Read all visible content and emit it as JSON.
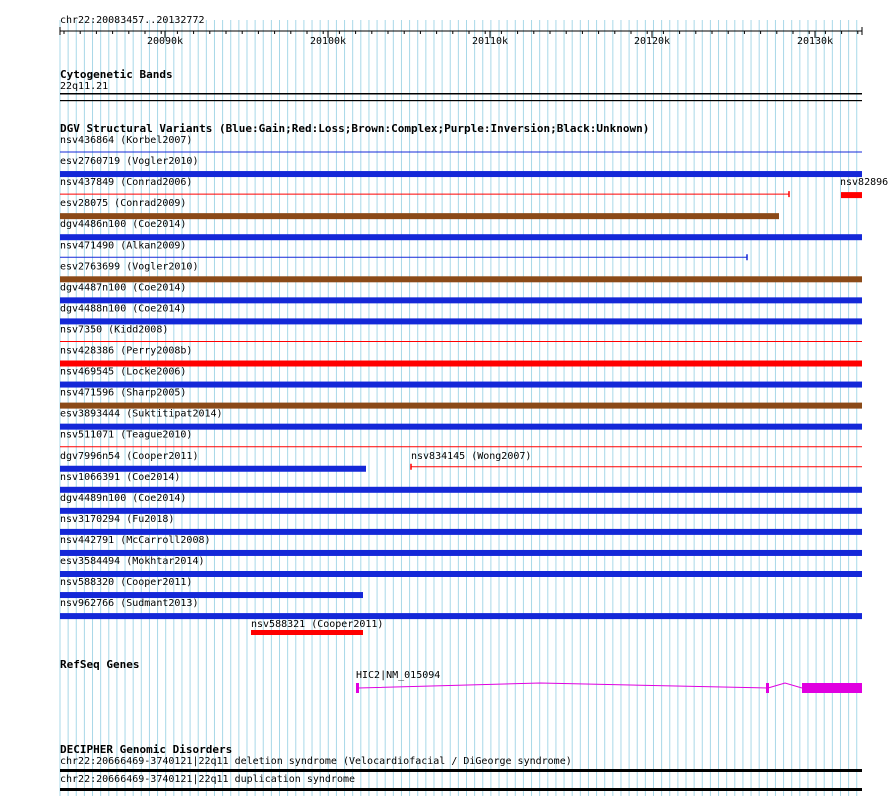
{
  "ruler": {
    "region": "chr22:20083457..20132772",
    "start": 20083457,
    "end": 20132772,
    "tick_labels": [
      "20090k",
      "20100k",
      "20110k",
      "20120k",
      "20130k"
    ]
  },
  "cytoband": {
    "title": "Cytogenetic Bands",
    "band": "22q11.21"
  },
  "dgv": {
    "title": "DGV Structural Variants (Blue:Gain;Red:Loss;Brown:Complex;Purple:Inversion;Black:Unknown)",
    "legend_colors": {
      "gain": "#1428d8",
      "loss": "#ff0000",
      "complex": "#8b4a18",
      "inversion": "#800080",
      "unknown": "#000000"
    },
    "features": [
      {
        "label": "nsv436864 (Korbel2007)",
        "type": "gain",
        "style": "line"
      },
      {
        "label": "esv2760719 (Vogler2010)",
        "type": "gain",
        "style": "bar"
      },
      {
        "label": "nsv437849 (Conrad2006)",
        "type": "loss",
        "style": "line-end",
        "extra_label": "nsv82896"
      },
      {
        "label": "esv28075 (Conrad2009)",
        "type": "complex",
        "style": "bar-partial"
      },
      {
        "label": "dgv4486n100 (Coe2014)",
        "type": "gain",
        "style": "bar"
      },
      {
        "label": "nsv471490 (Alkan2009)",
        "type": "gain",
        "style": "line-end"
      },
      {
        "label": "esv2763699 (Vogler2010)",
        "type": "complex",
        "style": "bar"
      },
      {
        "label": "dgv4487n100 (Coe2014)",
        "type": "gain",
        "style": "bar"
      },
      {
        "label": "dgv4488n100 (Coe2014)",
        "type": "gain",
        "style": "bar"
      },
      {
        "label": "nsv7350 (Kidd2008)",
        "type": "loss",
        "style": "line"
      },
      {
        "label": "nsv428386 (Perry2008b)",
        "type": "loss",
        "style": "bar"
      },
      {
        "label": "nsv469545 (Locke2006)",
        "type": "gain",
        "style": "bar"
      },
      {
        "label": "nsv471596 (Sharp2005)",
        "type": "complex",
        "style": "bar"
      },
      {
        "label": "esv3893444 (Suktitipat2014)",
        "type": "gain",
        "style": "bar"
      },
      {
        "label": "nsv511071 (Teague2010)",
        "type": "loss",
        "style": "line"
      },
      {
        "label": "dgv7996n54 (Cooper2011)",
        "type": "gain",
        "style": "bar-short",
        "second_label": "nsv834145 (Wong2007)"
      },
      {
        "label": "nsv1066391 (Coe2014)",
        "type": "gain",
        "style": "bar"
      },
      {
        "label": "dgv4489n100 (Coe2014)",
        "type": "gain",
        "style": "bar"
      },
      {
        "label": "nsv3170294 (Fu2018)",
        "type": "gain",
        "style": "bar"
      },
      {
        "label": "nsv442791 (McCarroll2008)",
        "type": "gain",
        "style": "bar"
      },
      {
        "label": "esv3584494 (Mokhtar2014)",
        "type": "gain",
        "style": "bar"
      },
      {
        "label": "nsv588320 (Cooper2011)",
        "type": "gain",
        "style": "bar-short"
      },
      {
        "label": "nsv962766 (Sudmant2013)",
        "type": "gain",
        "style": "bar"
      },
      {
        "label": "nsv588321 (Cooper2011)",
        "type": "loss",
        "style": "bar-short"
      }
    ]
  },
  "refseq": {
    "title": "RefSeq Genes",
    "gene_label": "HIC2|NM_015094",
    "gene_color": "#e000e0"
  },
  "decipher": {
    "title": "DECIPHER Genomic Disorders",
    "items": [
      "chr22:20666469-3740121|22q11 deletion syndrome (Velocardiofacial / DiGeorge syndrome)",
      "chr22:20666469-3740121|22q11 duplication syndrome"
    ]
  }
}
